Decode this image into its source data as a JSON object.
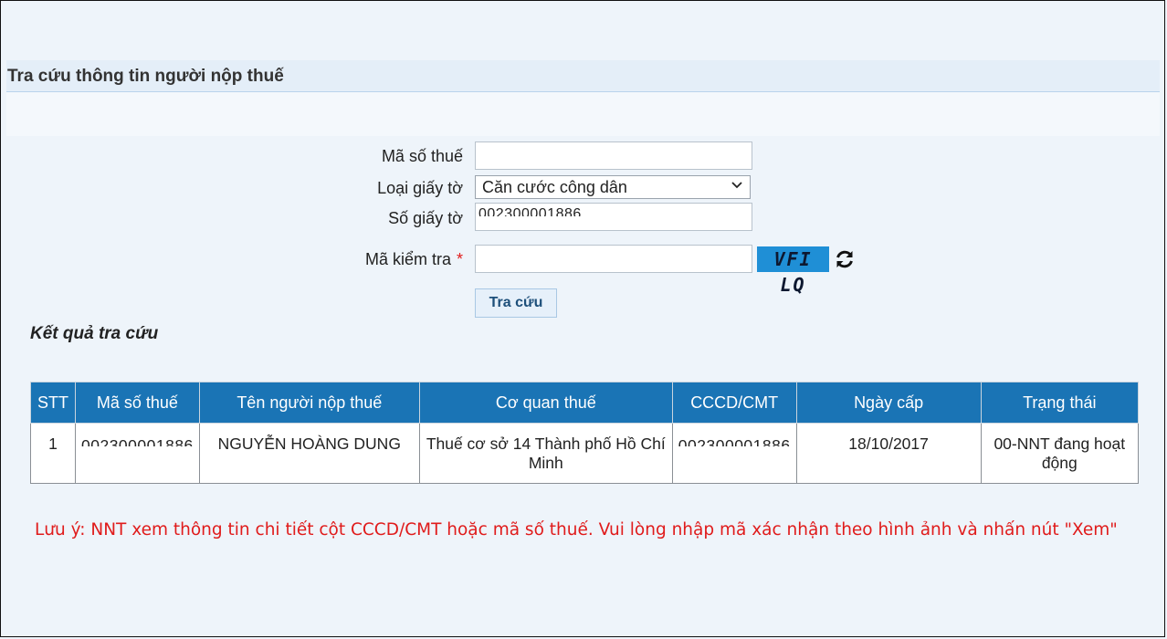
{
  "page": {
    "title": "Tra cứu thông tin người nộp thuế"
  },
  "form": {
    "tax_code_label": "Mã số thuế",
    "tax_code_value": "",
    "doc_type_label": "Loại giấy tờ",
    "doc_type_value": "Căn cước công dân",
    "doc_number_label": "Số giấy tờ",
    "doc_number_value": "002300001886",
    "captcha_label": "Mã kiểm tra",
    "captcha_required": "*",
    "captcha_value": "",
    "captcha_image_text": "VFI LQ",
    "submit_label": "Tra cứu"
  },
  "results": {
    "heading": "Kết quả tra cứu",
    "columns": [
      "STT",
      "Mã số thuế",
      "Tên người nộp thuế",
      "Cơ quan thuế",
      "CCCD/CMT",
      "Ngày cấp",
      "Trạng thái"
    ],
    "rows": [
      {
        "stt": "1",
        "tax_code": "002300001886",
        "name": "NGUYỄN HOÀNG DUNG",
        "agency": "Thuế cơ sở 14 Thành phố Hồ Chí Minh",
        "id_number": "002300001886",
        "issue_date": "18/10/2017",
        "status": "00-NNT đang hoạt động"
      }
    ]
  },
  "note": "Lưu ý: NNT xem thông tin chi tiết cột CCCD/CMT hoặc mã số thuế. Vui lòng nhập mã xác nhận theo hình ảnh và nhấn nút \"Xem\"",
  "colors": {
    "header_blue": "#1a74b5",
    "note_red": "#e01b1b",
    "captcha_bg": "#1f8fd6"
  }
}
